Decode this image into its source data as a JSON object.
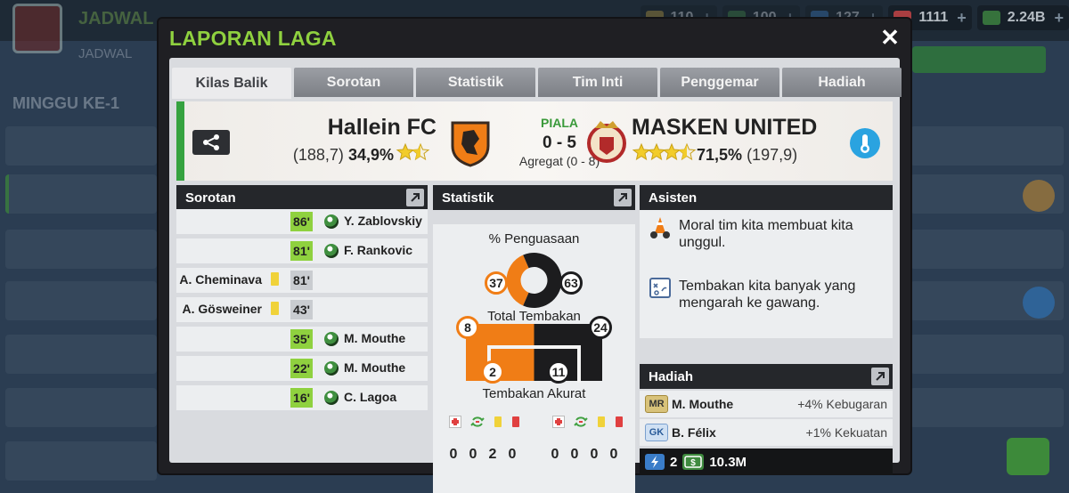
{
  "background": {
    "title": "JADWAL",
    "subtitle": "JADWAL",
    "week": "MINGGU KE-1",
    "currencies": [
      {
        "value": "110",
        "color": "#c7a23a"
      },
      {
        "value": "100",
        "color": "#3f8a3f"
      },
      {
        "value": "127",
        "color": "#3a7dc9"
      },
      {
        "value": "1111",
        "color": "#d84545"
      },
      {
        "value": "2.24B",
        "color": "#3f8a3f"
      }
    ]
  },
  "modal": {
    "title": "LAPORAN LAGA",
    "close_label": "✕"
  },
  "tabs": [
    "Kilas Balik",
    "Sorotan",
    "Statistik",
    "Tim Inti",
    "Penggemar",
    "Hadiah"
  ],
  "active_tab": "Kilas Balik",
  "match": {
    "home": {
      "name": "Hallein FC",
      "rating": "(188,7)",
      "percent": "34,9%",
      "stars": 1.5
    },
    "away": {
      "name": "MASKEN UNITED",
      "rating": "(197,9)",
      "percent": "71,5%",
      "stars": 3.5
    },
    "competition": "PIALA",
    "score": "0 - 5",
    "aggregate": "Agregat (0 - 8)"
  },
  "highlights": {
    "title": "Sorotan",
    "events": [
      {
        "side": "away",
        "minute": "86'",
        "player": "Y. Zablovskiy",
        "type": "goal"
      },
      {
        "side": "away",
        "minute": "81'",
        "player": "F. Rankovic",
        "type": "goal"
      },
      {
        "side": "home",
        "minute": "81'",
        "player": "A. Cheminava",
        "type": "yellow"
      },
      {
        "side": "home",
        "minute": "43'",
        "player": "A. Gösweiner",
        "type": "yellow"
      },
      {
        "side": "away",
        "minute": "35'",
        "player": "M. Mouthe",
        "type": "goal"
      },
      {
        "side": "away",
        "minute": "22'",
        "player": "M. Mouthe",
        "type": "goal"
      },
      {
        "side": "away",
        "minute": "16'",
        "player": "C. Lagoa",
        "type": "goal"
      }
    ]
  },
  "stats": {
    "title": "Statistik",
    "possession_label": "% Penguasaan",
    "possession_home": 37,
    "possession_away": 63,
    "shots_label": "Total Tembakan",
    "shots_home": 8,
    "shots_away": 24,
    "on_target_label": "Tembakan Akurat",
    "on_target_home": 2,
    "on_target_away": 11,
    "home_cards": [
      "0",
      "0",
      "2",
      "0"
    ],
    "away_cards": [
      "0",
      "0",
      "0",
      "0"
    ]
  },
  "assistant": {
    "title": "Asisten",
    "tips": [
      "Moral tim kita membuat kita unggul.",
      "Tembakan kita banyak yang mengarah ke gawang."
    ]
  },
  "rewards": {
    "title": "Hadiah",
    "items": [
      {
        "badge": "MR",
        "player": "M. Mouthe",
        "bonus": "+4% Kebugaran"
      },
      {
        "badge": "GK",
        "player": "B. Félix",
        "bonus": "+1% Kekuatan"
      }
    ],
    "energy": "2",
    "cash": "10.3M"
  },
  "colors": {
    "accent_green": "#8fd13f",
    "home_orange": "#f07d16",
    "away_black": "#1c1c1e"
  }
}
